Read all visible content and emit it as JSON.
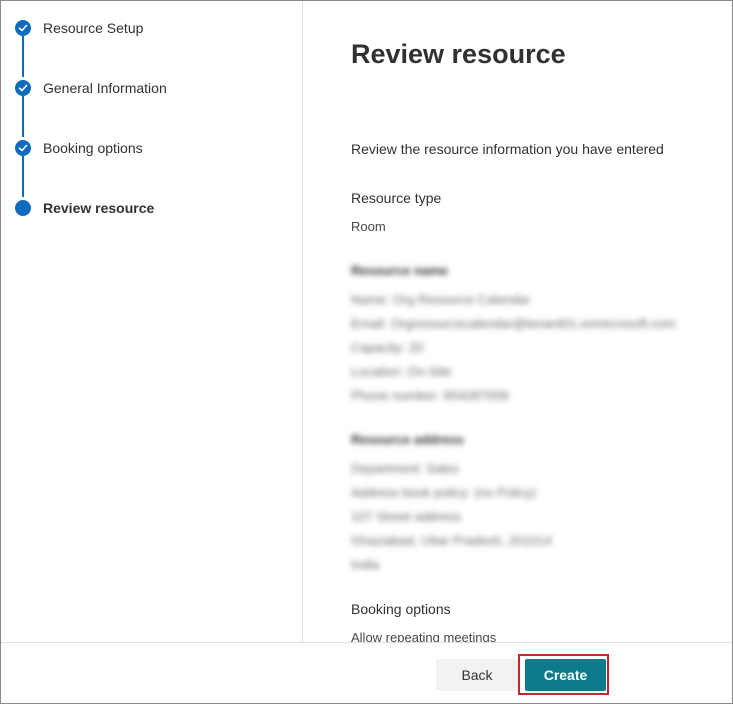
{
  "steps": [
    {
      "label": "Resource Setup",
      "state": "completed"
    },
    {
      "label": "General Information",
      "state": "completed"
    },
    {
      "label": "Booking options",
      "state": "completed"
    },
    {
      "label": "Review resource",
      "state": "current"
    }
  ],
  "main": {
    "title": "Review resource",
    "intro": "Review the resource information you have entered",
    "resource_type": {
      "heading": "Resource type",
      "value": "Room"
    },
    "resource_name": {
      "heading": "Resource name",
      "lines": [
        "Name: Org Resource Calendar",
        "Email: Orgresourcecalendar@tenant01.onmicrosoft.com",
        "Capacity: 20",
        "Location: On-Site",
        "Phone number: 954287009"
      ]
    },
    "resource_address": {
      "heading": "Resource address",
      "lines": [
        "Department: Sales",
        "Address book policy: (no Policy)",
        "107 Street address",
        "Ghaziabad, Uttar Pradesh, 201014",
        "India"
      ]
    },
    "booking_options": {
      "heading": "Booking options",
      "value": "Allow repeating meetings"
    }
  },
  "footer": {
    "back_label": "Back",
    "create_label": "Create"
  },
  "colors": {
    "step_accent": "#0f6cbd",
    "primary_button": "#0a7a8c",
    "highlight": "#c4262e"
  }
}
